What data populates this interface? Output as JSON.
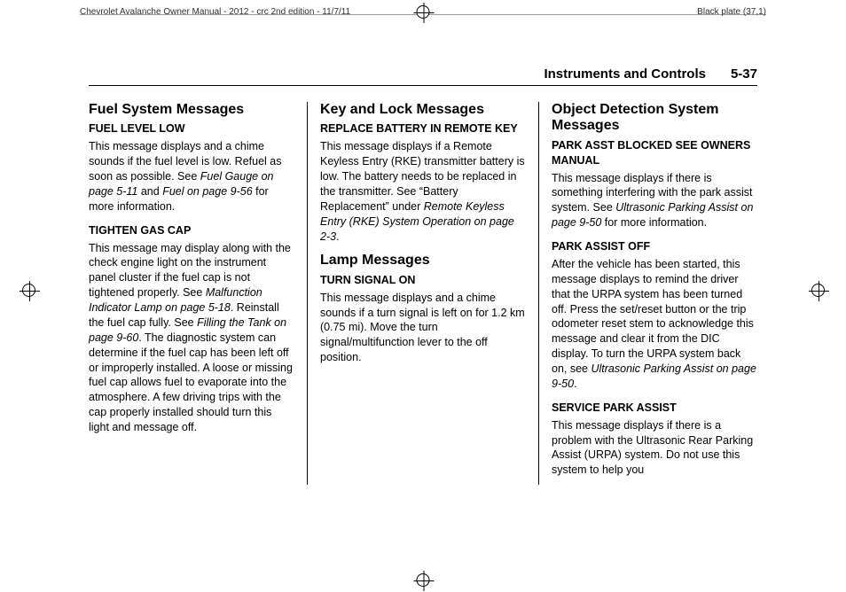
{
  "header": {
    "doc_title": "Chevrolet Avalanche Owner Manual - 2012 - crc 2nd edition - 11/7/11",
    "plate": "Black plate (37,1)"
  },
  "running_head": {
    "section": "Instruments and Controls",
    "pagenum": "5-37"
  },
  "col1": {
    "h1": "Fuel System Messages",
    "s1_h": "FUEL LEVEL LOW",
    "s1_p_a": "This message displays and a chime sounds if the fuel level is low. Refuel as soon as possible. See ",
    "s1_i1": "Fuel Gauge on page 5-11",
    "s1_mid": " and ",
    "s1_i2": "Fuel on page 9-56",
    "s1_end": " for more information.",
    "s2_h": "TIGHTEN GAS CAP",
    "s2_p_a": "This message may display along with the check engine light on the instrument panel cluster if the fuel cap is not tightened properly. See ",
    "s2_i1": "Malfunction Indicator Lamp on page 5-18",
    "s2_mid1": ". Reinstall the fuel cap fully. See ",
    "s2_i2": "Filling the Tank on page 9-60",
    "s2_end": ". The diagnostic system can determine if the fuel cap has been left off or improperly installed. A loose or missing fuel cap allows fuel to evaporate into the atmosphere. A few driving trips with the cap properly installed should turn this light and message off."
  },
  "col2": {
    "h1": "Key and Lock Messages",
    "s1_h": "REPLACE BATTERY IN REMOTE KEY",
    "s1_p_a": "This message displays if a Remote Keyless Entry (RKE) transmitter battery is low. The battery needs to be replaced in the transmitter. See “Battery Replacement” under ",
    "s1_i1": "Remote Keyless Entry (RKE) System Operation on page 2-3",
    "s1_end": ".",
    "h2": "Lamp Messages",
    "s2_h": "TURN SIGNAL ON",
    "s2_p": "This message displays and a chime sounds if a turn signal is left on for 1.2 km (0.75 mi). Move the turn signal/multifunction lever to the off position."
  },
  "col3": {
    "h1": "Object Detection System Messages",
    "s1_h": "PARK ASST BLOCKED SEE OWNERS MANUAL",
    "s1_p_a": "This message displays if there is something interfering with the park assist system. See ",
    "s1_i1": "Ultrasonic Parking Assist on page 9-50",
    "s1_end": " for more information.",
    "s2_h": "PARK ASSIST OFF",
    "s2_p_a": "After the vehicle has been started, this message displays to remind the driver that the URPA system has been turned off. Press the set/reset button or the trip odometer reset stem to acknowledge this message and clear it from the DIC display. To turn the URPA system back on, see ",
    "s2_i1": "Ultrasonic Parking Assist on page 9-50",
    "s2_end": ".",
    "s3_h": "SERVICE PARK ASSIST",
    "s3_p": "This message displays if there is a problem with the Ultrasonic Rear Parking Assist (URPA) system. Do not use this system to help you"
  }
}
